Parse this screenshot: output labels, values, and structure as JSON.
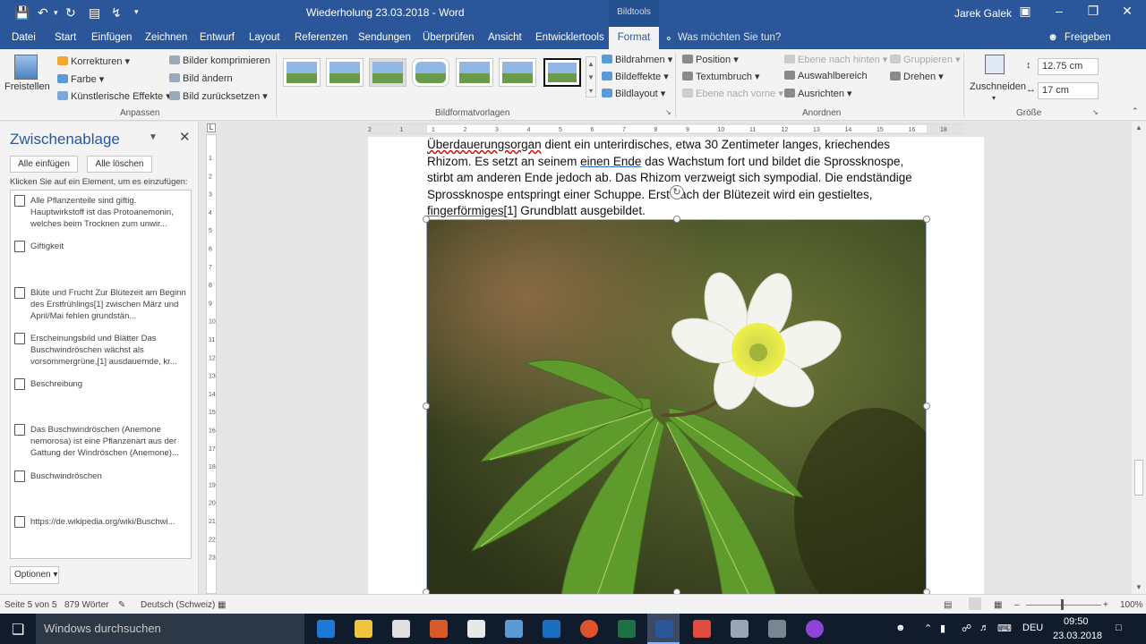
{
  "titlebar": {
    "document_title": "Wiederholung 23.03.2018 - Word",
    "context_tools": "Bildtools",
    "user": "Jarek Galek"
  },
  "tabs": [
    "Datei",
    "Start",
    "Einfügen",
    "Zeichnen",
    "Entwurf",
    "Layout",
    "Referenzen",
    "Sendungen",
    "Überprüfen",
    "Ansicht",
    "Entwicklertools"
  ],
  "active_tab": "Format",
  "tell_me": "Was möchten Sie tun?",
  "share": "Freigeben",
  "ribbon": {
    "freistellen": "Freistellen",
    "korrekturen": "Korrekturen",
    "farbe": "Farbe",
    "kuenstlerische_effekte": "Künstlerische Effekte",
    "bilder_komprimieren": "Bilder komprimieren",
    "bild_aendern": "Bild ändern",
    "bild_zuruecksetzen": "Bild zurücksetzen",
    "group_anpassen": "Anpassen",
    "group_bildformatvorlagen": "Bildformatvorlagen",
    "bildrahmen": "Bildrahmen",
    "bildeffekte": "Bildeffekte",
    "bildlayout": "Bildlayout",
    "position": "Position",
    "textumbruch": "Textumbruch",
    "ebene_nach_vorne": "Ebene nach vorne",
    "ebene_nach_hinten": "Ebene nach hinten",
    "auswahlbereich": "Auswahlbereich",
    "ausrichten": "Ausrichten",
    "gruppieren": "Gruppieren",
    "drehen": "Drehen",
    "group_anordnen": "Anordnen",
    "zuschneiden": "Zuschneiden",
    "height_value": "12.75 cm",
    "width_value": "17 cm",
    "group_groesse": "Größe"
  },
  "clipboard": {
    "title": "Zwischenablage",
    "paste_all": "Alle einfügen",
    "clear_all": "Alle löschen",
    "hint": "Klicken Sie auf ein Element, um es einzufügen:",
    "items": [
      "Alle Pflanzenteile sind giftig. Hauptwirkstoff ist das Protoanemonin, welches beim Trocknen zum unwir...",
      "Giftigkeit",
      "Blüte und Frucht Zur Blütezeit am Beginn des Erstfrühlings[1] zwischen März und April/Mai fehlen grundstän...",
      "Erscheinungsbild und Blätter Das Buschwindröschen wächst als vorsommergrüne,[1] ausdauernde, kr...",
      "Beschreibung",
      "Das Buschwindröschen (Anemone nemorosa) ist eine Pflanzenart aus der Gattung der Windröschen (Anemone)...",
      "Buschwindröschen",
      "https://de.wikipedia.org/wiki/Buschwi..."
    ],
    "options": "Optionen"
  },
  "document": {
    "line1_a": "Überdauerungsorgan",
    "line1_b": " dient ein unterirdisches, etwa 30 Zentimeter langes, kriechendes",
    "line2_a": "Rhizom. Es setzt an seinem ",
    "line2_link": "einen Ende",
    "line2_b": " das Wachstum fort und bildet die Sprossknospe,",
    "line3": "stirbt am anderen Ende jedoch ab. Das Rhizom verzweigt sich sympodial. Die endständige",
    "line4": "Sprossknospe entspringt einer Schuppe. Erst nach der Blütezeit wird ein gestieltes,",
    "line5_link": "fingerförmiges",
    "line5_b": "[1] Grundblatt ausgebildet."
  },
  "ruler_numbers": [
    "2",
    "1",
    "1",
    "2",
    "3",
    "4",
    "5",
    "6",
    "7",
    "8",
    "9",
    "10",
    "11",
    "12",
    "13",
    "14",
    "15",
    "16",
    "18"
  ],
  "vruler_numbers": [
    "1",
    "2",
    "3",
    "4",
    "5",
    "6",
    "7",
    "8",
    "9",
    "10",
    "11",
    "12",
    "13",
    "14",
    "15",
    "16",
    "17",
    "18",
    "19",
    "20",
    "21",
    "22",
    "23"
  ],
  "status": {
    "page": "Seite 5 von 5",
    "words": "879 Wörter",
    "language": "Deutsch (Schweiz)",
    "zoom": "100%"
  },
  "taskbar": {
    "search_placeholder": "Windows durchsuchen",
    "lang": "DEU",
    "time": "09:50",
    "date": "23.03.2018"
  }
}
